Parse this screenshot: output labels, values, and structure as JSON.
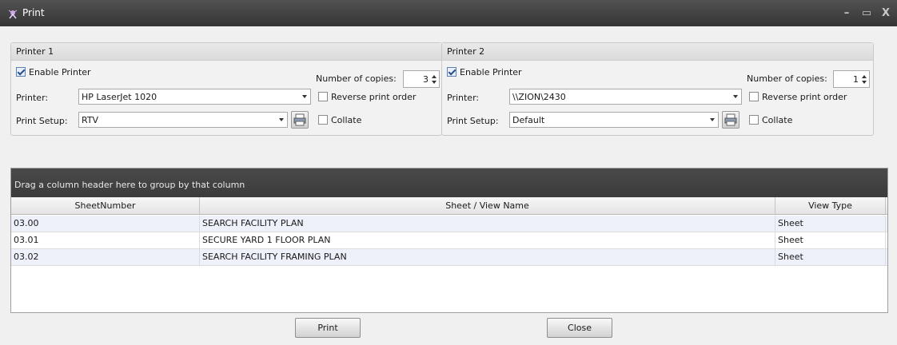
{
  "window": {
    "title": "Print",
    "minimize": "–",
    "maximize": "▭",
    "close": "X"
  },
  "printer1": {
    "group_title": "Printer 1",
    "enable_label": "Enable Printer",
    "enabled": true,
    "printer_label": "Printer:",
    "printer_value": "HP LaserJet 1020",
    "setup_label": "Print Setup:",
    "setup_value": "RTV",
    "copies_label": "Number of copies:",
    "copies_value": "3",
    "reverse_label": "Reverse print order",
    "reverse_checked": false,
    "collate_label": "Collate",
    "collate_checked": false
  },
  "printer2": {
    "group_title": "Printer 2",
    "enable_label": "Enable Printer",
    "enabled": true,
    "printer_label": "Printer:",
    "printer_value": "\\\\ZION\\2430",
    "setup_label": "Print Setup:",
    "setup_value": "Default",
    "copies_label": "Number of copies:",
    "copies_value": "1",
    "reverse_label": "Reverse print order",
    "reverse_checked": false,
    "collate_label": "Collate",
    "collate_checked": false
  },
  "grid": {
    "group_panel_text": "Drag a column header here to group by that column",
    "columns": [
      "SheetNumber",
      "Sheet / View Name",
      "View Type"
    ],
    "rows": [
      [
        "03.00",
        "SEARCH FACILITY PLAN",
        "Sheet"
      ],
      [
        "03.01",
        "SECURE YARD 1 FLOOR PLAN",
        "Sheet"
      ],
      [
        "03.02",
        "SEARCH FACILITY FRAMING PLAN",
        "Sheet"
      ]
    ]
  },
  "buttons": {
    "print": "Print",
    "close": "Close"
  },
  "icons": {
    "app": "app-icon",
    "print_setup": "printer-icon"
  },
  "colors": {
    "titlebar": "#3f3f3f",
    "group_panel": "#424242",
    "alt_row": "#eef1fa"
  }
}
